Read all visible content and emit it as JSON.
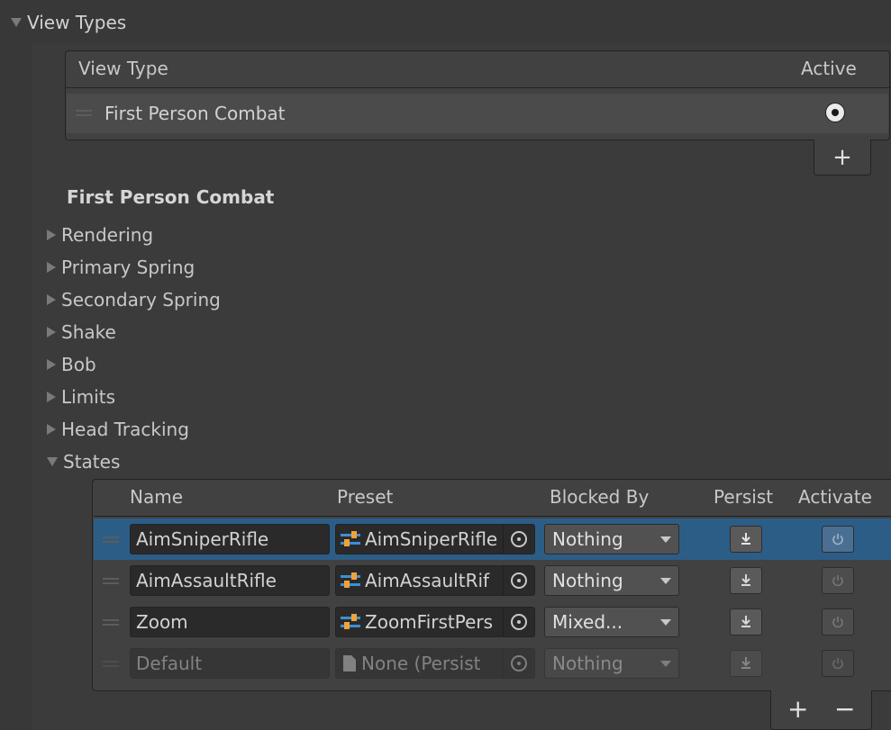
{
  "section_title": "View Types",
  "view_type_list": {
    "col_view_type": "View Type",
    "col_active": "Active",
    "rows": [
      {
        "name": "First Person Combat",
        "active": true
      }
    ],
    "add_label": "+"
  },
  "selected_view": {
    "heading": "First Person Combat",
    "foldouts": [
      "Rendering",
      "Primary Spring",
      "Secondary Spring",
      "Shake",
      "Bob",
      "Limits",
      "Head Tracking"
    ],
    "states_label": "States"
  },
  "states": {
    "headers": {
      "name": "Name",
      "preset": "Preset",
      "blocked_by": "Blocked By",
      "persist": "Persist",
      "activate": "Activate"
    },
    "rows": [
      {
        "name": "AimSniperRifle",
        "preset": "AimSniperRifle",
        "blocked_by": "Nothing",
        "selected": true,
        "disabled": false
      },
      {
        "name": "AimAssaultRifle",
        "preset": "AimAssaultRif",
        "blocked_by": "Nothing",
        "selected": false,
        "disabled": false
      },
      {
        "name": "Zoom",
        "preset": "ZoomFirstPers",
        "blocked_by": "Mixed...",
        "selected": false,
        "disabled": false
      },
      {
        "name": "Default",
        "preset": "None (Persist",
        "blocked_by": "Nothing",
        "selected": false,
        "disabled": true
      }
    ],
    "add_label": "+",
    "remove_label": "−"
  },
  "colors": {
    "background": "#383838",
    "selected_row": "#2c5d87",
    "preset_icon_blue": "#3d8fd6",
    "preset_icon_orange": "#f2a23a"
  }
}
